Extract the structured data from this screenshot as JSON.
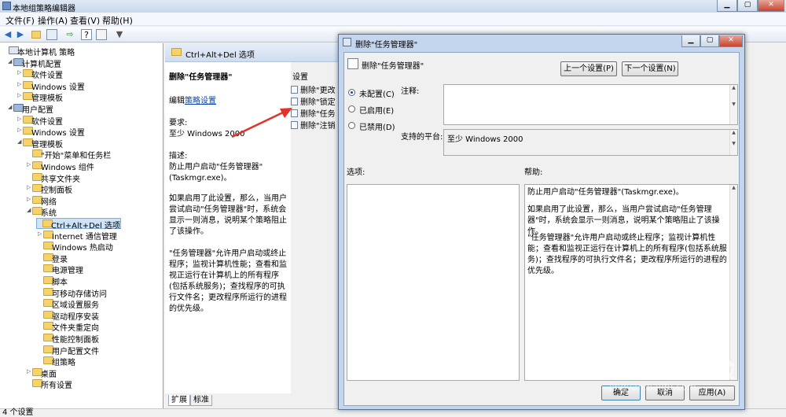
{
  "window": {
    "title": "本地组策略编辑器"
  },
  "menu": [
    "文件(F)",
    "操作(A)",
    "查看(V)",
    "帮助(H)"
  ],
  "tree": [
    {
      "label": "本地计算机 策略",
      "level": 0,
      "exp": ""
    },
    {
      "label": "计算机配置",
      "level": 1,
      "exp": "◢"
    },
    {
      "label": "软件设置",
      "level": 2,
      "exp": "▷"
    },
    {
      "label": "Windows 设置",
      "level": 2,
      "exp": "▷"
    },
    {
      "label": "管理模板",
      "level": 2,
      "exp": "▷"
    },
    {
      "label": "用户配置",
      "level": 1,
      "exp": "◢"
    },
    {
      "label": "软件设置",
      "level": 2,
      "exp": "▷"
    },
    {
      "label": "Windows 设置",
      "level": 2,
      "exp": "▷"
    },
    {
      "label": "管理模板",
      "level": 2,
      "exp": "◢"
    },
    {
      "label": "\"开始\"菜单和任务栏",
      "level": 3,
      "exp": ""
    },
    {
      "label": "Windows 组件",
      "level": 3,
      "exp": "▷"
    },
    {
      "label": "共享文件夹",
      "level": 3,
      "exp": ""
    },
    {
      "label": "控制面板",
      "level": 3,
      "exp": "▷"
    },
    {
      "label": "网络",
      "level": 3,
      "exp": "▷"
    },
    {
      "label": "系统",
      "level": 3,
      "exp": "◢"
    },
    {
      "label": "Ctrl+Alt+Del 选项",
      "level": 4,
      "exp": "",
      "selected": true
    },
    {
      "label": "Internet 通信管理",
      "level": 4,
      "exp": "▷"
    },
    {
      "label": "Windows 热启动",
      "level": 4,
      "exp": ""
    },
    {
      "label": "登录",
      "level": 4,
      "exp": ""
    },
    {
      "label": "电源管理",
      "level": 4,
      "exp": ""
    },
    {
      "label": "脚本",
      "level": 4,
      "exp": ""
    },
    {
      "label": "可移动存储访问",
      "level": 4,
      "exp": ""
    },
    {
      "label": "区域设置服务",
      "level": 4,
      "exp": ""
    },
    {
      "label": "驱动程序安装",
      "level": 4,
      "exp": ""
    },
    {
      "label": "文件夹重定向",
      "level": 4,
      "exp": ""
    },
    {
      "label": "性能控制面板",
      "level": 4,
      "exp": ""
    },
    {
      "label": "用户配置文件",
      "level": 4,
      "exp": ""
    },
    {
      "label": "组策略",
      "level": 4,
      "exp": ""
    },
    {
      "label": "桌面",
      "level": 3,
      "exp": "▷"
    },
    {
      "label": "所有设置",
      "level": 3,
      "exp": ""
    }
  ],
  "detail": {
    "header": "Ctrl+Alt+Del 选项",
    "policy_title": "删除\"任务管理器\"",
    "edit_prefix": "编辑",
    "edit_link": "策略设置",
    "req_label": "要求:",
    "req_value": "至少 Windows 2000",
    "desc_label": "描述:",
    "desc_1": "防止用户启动\"任务管理器\"(Taskmgr.exe)。",
    "desc_2": "如果启用了此设置，那么，当用户尝试启动\"任务管理器\"时，系统会显示一则消息，说明某个策略阻止了该操作。",
    "desc_3": "\"任务管理器\"允许用户启动或终止程序；监视计算机性能；查看和监视正运行在计算机上的所有程序(包括系统服务)；查找程序的可执行文件名；更改程序所运行的进程的优先级。"
  },
  "settings": {
    "header": "设置",
    "rows": [
      "删除\"更改",
      "删除\"锁定",
      "删除\"任务",
      "删除\"注销"
    ]
  },
  "tabs": [
    "扩展",
    "标准"
  ],
  "status": "4 个设置",
  "dialog": {
    "title": "删除\"任务管理器\"",
    "heading": "删除\"任务管理器\"",
    "prev": "上一个设置(P)",
    "next": "下一个设置(N)",
    "not_configured": "未配置(C)",
    "enabled": "已启用(E)",
    "disabled": "已禁用(D)",
    "comment_label": "注释:",
    "platform_label": "支持的平台:",
    "platform_value": "至少 Windows 2000",
    "options_label": "选项:",
    "help_label": "帮助:",
    "help_1": "防止用户启动\"任务管理器\"(Taskmgr.exe)。",
    "help_2": "如果启用了此设置，那么，当用户尝试启动\"任务管理器\"时，系统会显示一则消息，说明某个策略阻止了该操作。",
    "help_3": "\"任务管理器\"允许用户启动或终止程序；监视计算机性能；查看和监视正运行在计算机上的所有程序(包括系统服务)；查找程序的可执行文件名；更改程序所运行的进程的优先级。",
    "ok": "确定",
    "cancel": "取消",
    "apply": "应用(A)"
  },
  "watermark": {
    "logo": "Bai du 经验",
    "url": "jingyan.baidu.com"
  },
  "colors": {
    "arrow": "#e0342a",
    "selection": "#cde3f8",
    "titlebar": "#c4d6ee"
  }
}
